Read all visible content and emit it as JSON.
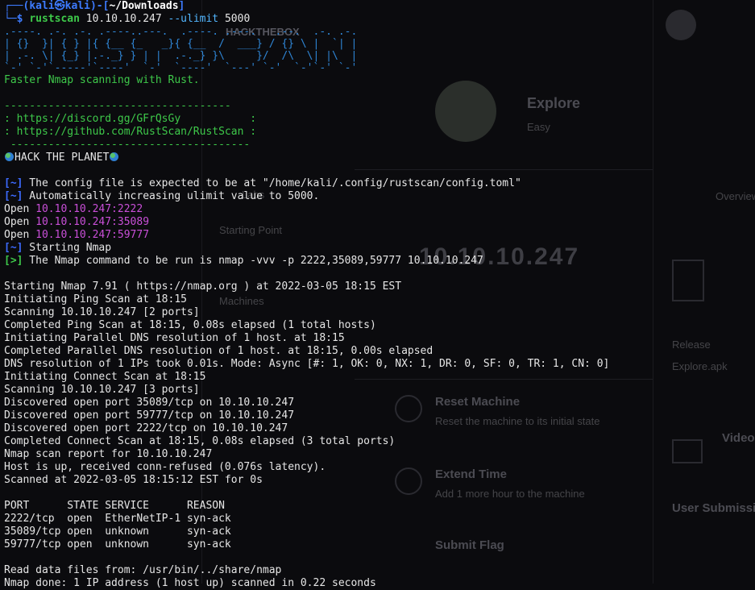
{
  "background": {
    "labels": [
      "HACKTHEBOX",
      "Explore",
      "Easy",
      "Starting Point",
      "Labs",
      "Machines",
      "10.10.10.247",
      "Reset Machine",
      "Reset the machine to its initial state",
      "Extend Time",
      "Add 1 more hour to the machine",
      "Submit Flag",
      "User Submissions",
      "Video",
      "Explore.apk",
      "Overview",
      "Release"
    ]
  },
  "prompt": {
    "corner": "┌──(",
    "user": "kali",
    "at": "㉿",
    "host": "kali",
    "sep": ")-[",
    "path": "~/Downloads",
    "close": "]",
    "dollar_prefix": "└─",
    "dollar": "$ ",
    "command": "rustscan",
    "args": " 10.10.10.247 ",
    "flag": "--ulimit",
    "flag_value": " 5000"
  },
  "banner_lines": [
    ".----. .-. .-. .----..---.  .----. .---.   .--.  .-. .-.",
    "| {}  }| { } |{ {__ {_   _}{ {__  /  ___} / {} \\ |  `| |",
    "| .-. \\| {_} |.-._} } | |  .-._} }\\     }/  /\\  \\| |\\  |",
    "`-' `-'`-----'`----'  `-'  `----'  `---' `-'  `-'`-' `-'"
  ],
  "tagline": "Faster Nmap scanning with Rust.",
  "box": {
    "rule_top": "------------------------------------",
    "discord": ": https://discord.gg/GFrQsGy           :",
    "github": ": https://github.com/RustScan/RustScan :",
    "rule_bottom": " --------------------------------------"
  },
  "hack": "HACK THE PLANET",
  "messages": {
    "m1_tag": "[~]",
    "m1": " The config file is expected to be at \"/home/kali/.config/rustscan/config.toml\"",
    "m2_tag": "[~]",
    "m2": " Automatically increasing ulimit value to 5000.",
    "open_label": "Open ",
    "open1": "10.10.10.247:2222",
    "open2": "10.10.10.247:35089",
    "open3": "10.10.10.247:59777",
    "m3_tag": "[~]",
    "m3": " Starting Nmap",
    "m4_tag": "[>]",
    "m4": " The Nmap command to be run is nmap -vvv -p 2222,35089,59777 10.10.10.247"
  },
  "nmap_lines": [
    "Starting Nmap 7.91 ( https://nmap.org ) at 2022-03-05 18:15 EST",
    "Initiating Ping Scan at 18:15",
    "Scanning 10.10.10.247 [2 ports]",
    "Completed Ping Scan at 18:15, 0.08s elapsed (1 total hosts)",
    "Initiating Parallel DNS resolution of 1 host. at 18:15",
    "Completed Parallel DNS resolution of 1 host. at 18:15, 0.00s elapsed",
    "DNS resolution of 1 IPs took 0.01s. Mode: Async [#: 1, OK: 0, NX: 1, DR: 0, SF: 0, TR: 1, CN: 0]",
    "Initiating Connect Scan at 18:15",
    "Scanning 10.10.10.247 [3 ports]",
    "Discovered open port 35089/tcp on 10.10.10.247",
    "Discovered open port 59777/tcp on 10.10.10.247",
    "Discovered open port 2222/tcp on 10.10.10.247",
    "Completed Connect Scan at 18:15, 0.08s elapsed (3 total ports)",
    "Nmap scan report for 10.10.10.247",
    "Host is up, received conn-refused (0.076s latency).",
    "Scanned at 2022-03-05 18:15:12 EST for 0s"
  ],
  "port_table": {
    "header": "PORT      STATE SERVICE      REASON",
    "rows": [
      "2222/tcp  open  EtherNetIP-1 syn-ack",
      "35089/tcp open  unknown      syn-ack",
      "59777/tcp open  unknown      syn-ack"
    ]
  },
  "footer_lines": [
    "Read data files from: /usr/bin/../share/nmap",
    "Nmap done: 1 IP address (1 host up) scanned in 0.22 seconds"
  ],
  "colors": {
    "prompt_blue": "#3d7bff",
    "open_magenta": "#c94fd8",
    "banner_blue": "#2f86d6",
    "green": "#3ec94a"
  }
}
